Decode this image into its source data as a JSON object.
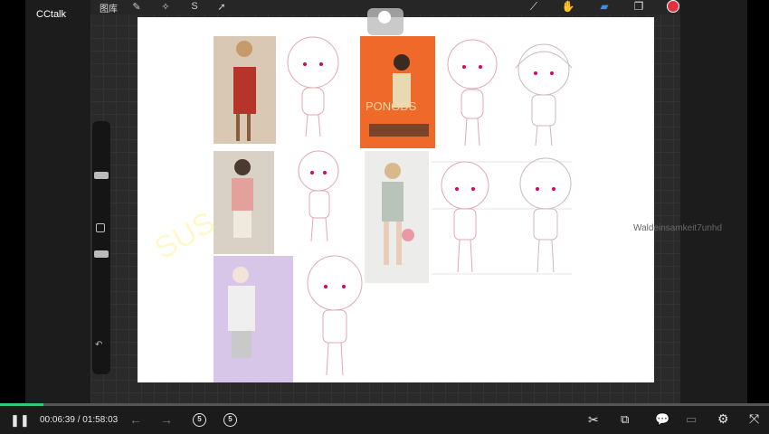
{
  "app": {
    "title": "CCtalk"
  },
  "procreate": {
    "gallery_label": "图库",
    "tools": [
      "wrench-icon",
      "magic-wand-icon",
      "selection-icon",
      "transform-arrow-icon"
    ],
    "right_tools": [
      "brush-icon",
      "smudge-icon",
      "eraser-icon",
      "layers-icon"
    ],
    "active_color": "#e3303f"
  },
  "canvas": {
    "book_text": "PONGDS"
  },
  "watermark": "Waldeinsamkeit7unhd",
  "player": {
    "current_time": "00:06:39",
    "separator": "/",
    "total_time": "01:58:03",
    "progress": 0.056,
    "rewind_label": "5",
    "forward_label": "5",
    "accent": "#2ecc71"
  }
}
